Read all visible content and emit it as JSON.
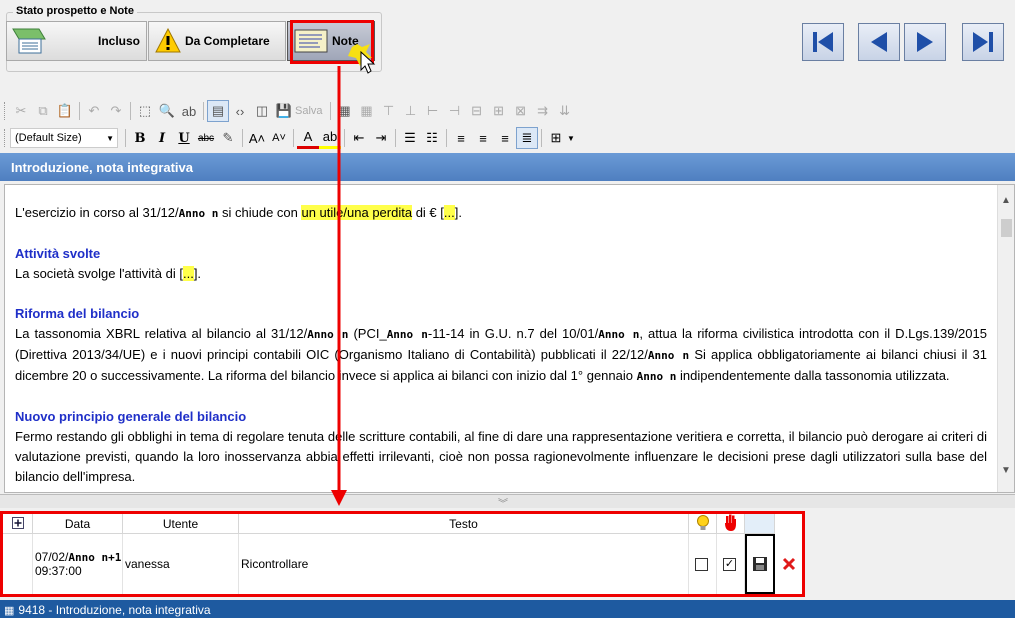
{
  "status_group": {
    "title": "Stato prospetto e Note",
    "btn_incluso": "Incluso",
    "btn_da_completare": "Da Completare",
    "btn_note": "Note"
  },
  "toolbar": {
    "save_label": "Salva",
    "font_size": "(Default Size)"
  },
  "section": {
    "title": "Introduzione, nota integrativa"
  },
  "editor": {
    "p1_a": "L'esercizio in corso al 31/12/",
    "p1_anno": "Anno n",
    "p1_b": " si chiude con ",
    "p1_hl": "un utile/una perdita",
    "p1_c": " di € [",
    "p1_hl2": "...",
    "p1_d": "].",
    "h_attivita": "Attività svolte",
    "p2_a": "La società svolge l'attività di [",
    "p2_hl": "...",
    "p2_b": "].",
    "h_riforma": "Riforma del bilancio",
    "p3_a": "La tassonomia XBRL relativa al bilancio al 31/12/",
    "p3_anno1": "Anno n",
    "p3_b": " (PCI_",
    "p3_anno2": "Anno n",
    "p3_c": "-11-14 in G.U. n.7 del 10/01/",
    "p3_anno3": "Anno n",
    "p3_d": ", attua la riforma civilistica introdotta con il D.Lgs.139/2015 (Direttiva 2013/34/UE) e i nuovi principi contabili OIC (Organismo Italiano di Contabilità) pubblicati il 22/12/",
    "p3_anno4": "Anno n",
    "p3_e": " Si applica obbligatoriamente ai bilanci chiusi il 31 dicembre 20",
    "p3_f": " o successivamente. La riforma del bilancio invece si applica ai bilanci con inizio dal 1° gennaio ",
    "p3_anno5": "Anno n",
    "p3_g": " indipendentemente dalla tassonomia utilizzata.",
    "h_principio": "Nuovo principio generale del bilancio",
    "p4": "Fermo restando gli obblighi in tema di regolare tenuta delle scritture contabili, al fine di dare una rappresentazione veritiera e corretta, il bilancio può derogare ai criteri di valutazione previsti, quando la loro inosservanza abbia effetti irrilevanti, cioè non possa ragionevolmente influenzare le decisioni prese dagli utilizzatori sulla base del bilancio dell'impresa."
  },
  "notes_grid": {
    "columns": [
      "Data",
      "Utente",
      "Testo"
    ],
    "rows": [
      {
        "date_a": "07/02/",
        "date_anno": "Anno n+1",
        "time": "09:37:00",
        "utente": "vanessa",
        "testo": "Ricontrollare",
        "lamp_checked": false,
        "stop_checked": true
      }
    ]
  },
  "statusbar": {
    "text": "9418 - Introduzione, nota integrativa"
  },
  "colors": {
    "accent": "#4f7fc0",
    "highlight_red": "#e00000",
    "heading_blue": "#1f2fc8",
    "status_bar": "#1e5aa0"
  }
}
